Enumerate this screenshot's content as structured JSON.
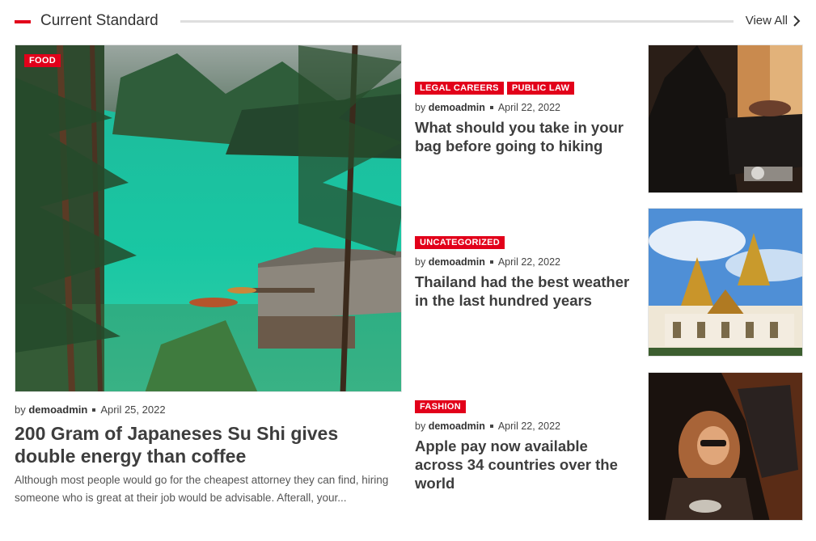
{
  "section": {
    "title": "Current Standard",
    "view_all": "View All"
  },
  "feature": {
    "category": "FOOD",
    "by": "by",
    "author": "demoadmin",
    "date": "April 25, 2022",
    "title": "200 Gram of Japaneses Su Shi gives double energy than coffee",
    "excerpt": "Although most people would go for the cheapest attorney they can find, hiring someone who is great at their job would be advisable. Afterall, your..."
  },
  "posts": [
    {
      "categories": [
        "LEGAL CAREERS",
        "PUBLIC LAW"
      ],
      "by": "by",
      "author": "demoadmin",
      "date": "April 22, 2022",
      "title": "What should you take in your bag before going to hiking"
    },
    {
      "categories": [
        "UNCATEGORIZED"
      ],
      "by": "by",
      "author": "demoadmin",
      "date": "April 22, 2022",
      "title": "Thailand had the best weather in the last hundred years"
    },
    {
      "categories": [
        "FASHION"
      ],
      "by": "by",
      "author": "demoadmin",
      "date": "April 22, 2022",
      "title": "Apple pay now available across 34 countries over the world"
    }
  ],
  "colors": {
    "accent": "#e2001a",
    "text": "#3d3d3d"
  }
}
